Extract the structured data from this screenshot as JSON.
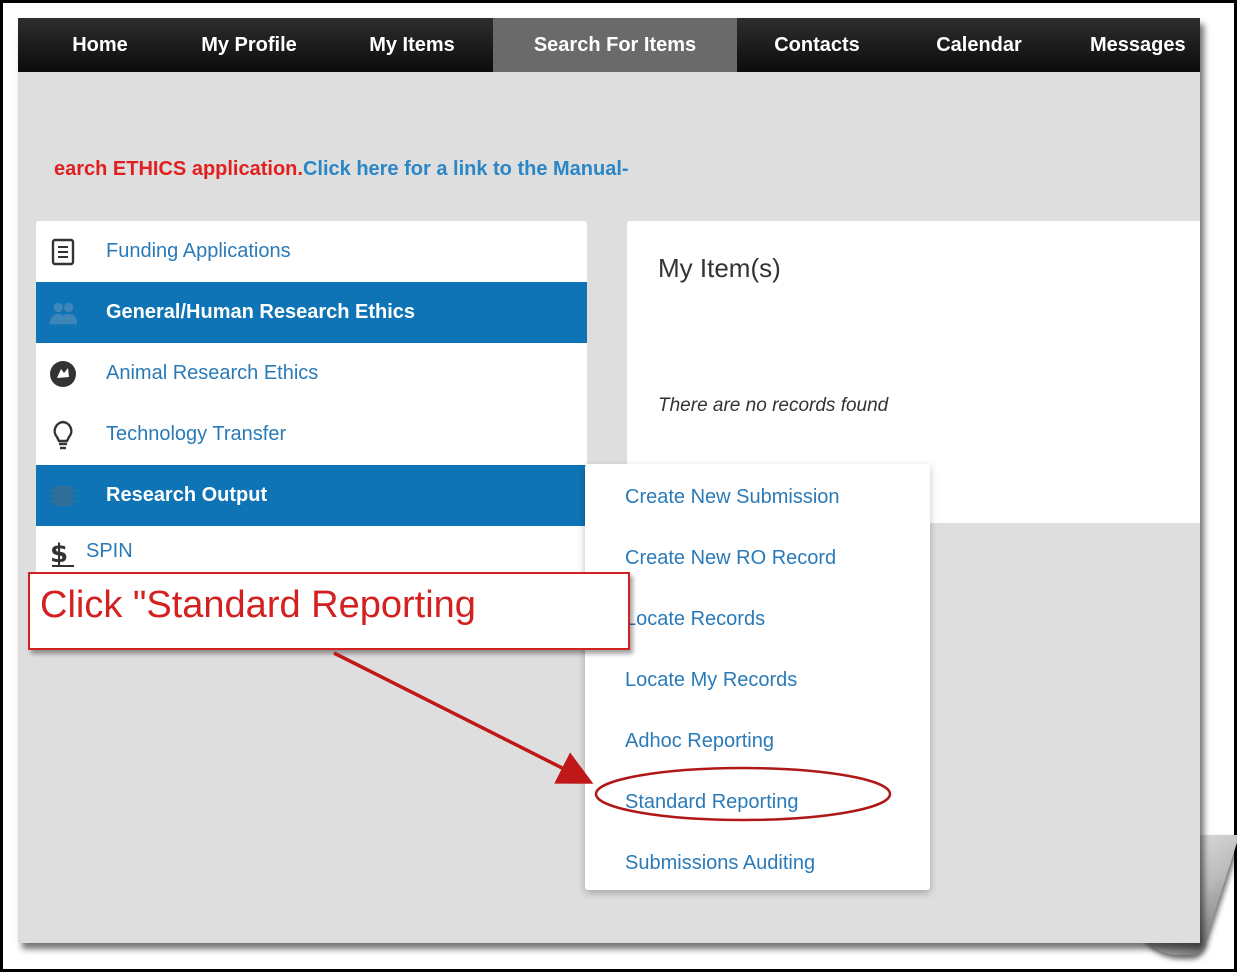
{
  "navbar": {
    "items": [
      {
        "label": "Home"
      },
      {
        "label": "My Profile"
      },
      {
        "label": "My Items"
      },
      {
        "label": "Search For Items",
        "active": true
      },
      {
        "label": "Contacts"
      },
      {
        "label": "Calendar"
      },
      {
        "label": "Messages"
      }
    ]
  },
  "banner": {
    "red_text": "earch ETHICS application.",
    "link_text": "Click here for a link to the Manual-"
  },
  "sidebar": {
    "items": [
      {
        "label": "Funding Applications",
        "icon": "document-icon"
      },
      {
        "label": "General/Human Research Ethics",
        "icon": "people-icon",
        "active": true
      },
      {
        "label": "Animal Research Ethics",
        "icon": "animal-icon"
      },
      {
        "label": "Technology Transfer",
        "icon": "lightbulb-icon"
      },
      {
        "label": "Research Output",
        "icon": "chip-icon",
        "active": true
      },
      {
        "label": "SPIN",
        "icon": "dollar-icon"
      }
    ]
  },
  "content": {
    "title": "My Item(s)",
    "empty_message": "There are no records found"
  },
  "dropdown": {
    "items": [
      {
        "label": "Create New Submission"
      },
      {
        "label": "Create New RO Record"
      },
      {
        "label": "Locate Records"
      },
      {
        "label": "Locate My Records"
      },
      {
        "label": "Adhoc Reporting"
      },
      {
        "label": "Standard Reporting",
        "highlighted": true
      },
      {
        "label": "Submissions Auditing"
      }
    ]
  },
  "annotation": {
    "callout_text": "Click \"Standard Reporting",
    "color": "#d32020"
  },
  "colors": {
    "nav_bg": "#1a1a1a",
    "nav_active": "#6a6a6a",
    "sidebar_active": "#0e74b5",
    "link": "#2a7ab8",
    "banner_red": "#e02020",
    "page_bg": "#dedede"
  }
}
